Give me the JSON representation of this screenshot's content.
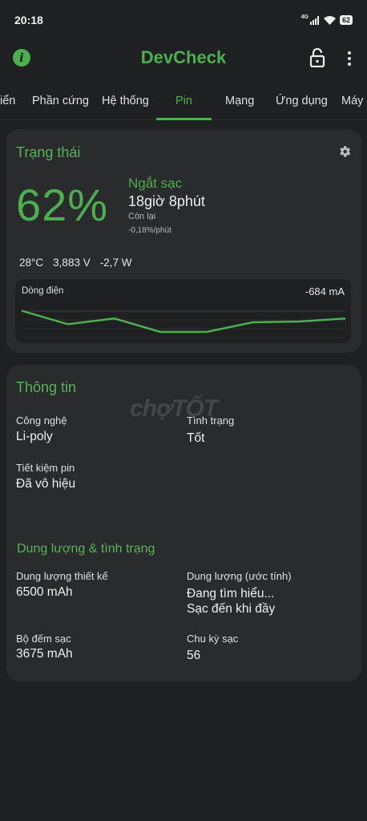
{
  "status_bar": {
    "time": "20:18",
    "network": "4G",
    "battery": "62"
  },
  "app_bar": {
    "title": "DevCheck",
    "accent_color": "#4caf50"
  },
  "tabs": [
    {
      "label": "iển"
    },
    {
      "label": "Phần cứng"
    },
    {
      "label": "Hệ thống"
    },
    {
      "label": "Pin",
      "active": true
    },
    {
      "label": "Mạng"
    },
    {
      "label": "Ứng dụng"
    },
    {
      "label": "Máy ả"
    }
  ],
  "status_card": {
    "title": "Trạng thái",
    "percent": "62%",
    "charge_state": "Ngắt sạc",
    "time_left": "18giờ 8phút",
    "time_left_label": "Còn lại",
    "rate": "-0,18%/phút",
    "temperature": "28°C",
    "voltage": "3,883 V",
    "power": "-2,7 W",
    "current_label": "Dòng điện",
    "current_value": "-684 mA",
    "current_series": [
      -0.2,
      -0.55,
      -0.4,
      -0.75,
      -0.75,
      -0.5,
      -0.48,
      -0.4
    ]
  },
  "info_card": {
    "title": "Thông tin",
    "watermark": "chợTỐT",
    "technology_label": "Công nghệ",
    "technology_value": "Li-poly",
    "health_label": "Tình trạng",
    "health_value": "Tốt",
    "saver_label": "Tiết kiệm pin",
    "saver_value": "Đã vô hiệu",
    "capacity_section_title": "Dung lượng & tình trạng",
    "design_capacity_label": "Dung lượng thiết kế",
    "design_capacity_value": "6500 mAh",
    "estimated_capacity_label": "Dung lượng (ước tính)",
    "estimated_capacity_value_1": "Đang tìm hiểu...",
    "estimated_capacity_value_2": "Sạc đến khi đầy",
    "charge_counter_label": "Bộ đếm sạc",
    "charge_counter_value": "3675 mAh",
    "cycle_label": "Chu kỳ sạc",
    "cycle_value": "56"
  }
}
